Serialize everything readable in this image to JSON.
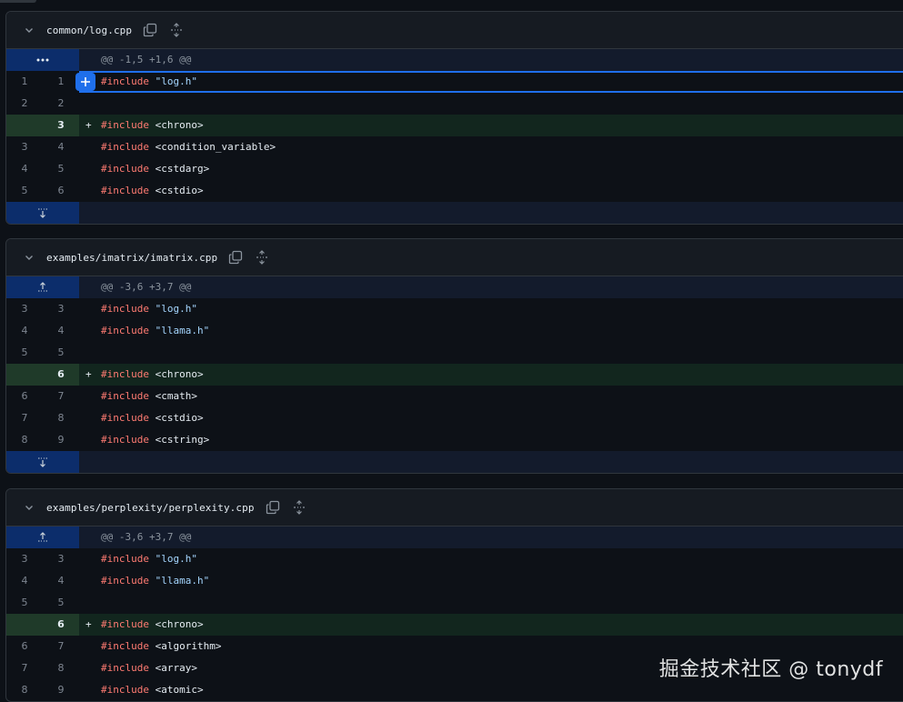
{
  "files": [
    {
      "name": "common/log.cpp",
      "hunk": "@@ -1,5 +1,6 @@",
      "hunk_type": "ellipsis",
      "lines": [
        {
          "type": "ctx",
          "old": "1",
          "new": "1",
          "pre": "#include",
          "arg": "\"log.h\"",
          "arg_kind": "str",
          "selected": true
        },
        {
          "type": "ctx",
          "old": "2",
          "new": "2",
          "pre": "",
          "arg": "",
          "arg_kind": "str"
        },
        {
          "type": "add",
          "old": "",
          "new": "3",
          "mark": "+",
          "pre": "#include",
          "arg": "<chrono>",
          "arg_kind": "plain"
        },
        {
          "type": "ctx",
          "old": "3",
          "new": "4",
          "pre": "#include",
          "arg": "<condition_variable>",
          "arg_kind": "plain"
        },
        {
          "type": "ctx",
          "old": "4",
          "new": "5",
          "pre": "#include",
          "arg": "<cstdarg>",
          "arg_kind": "plain"
        },
        {
          "type": "ctx",
          "old": "5",
          "new": "6",
          "pre": "#include",
          "arg": "<cstdio>",
          "arg_kind": "plain"
        }
      ]
    },
    {
      "name": "examples/imatrix/imatrix.cpp",
      "hunk": "@@ -3,6 +3,7 @@",
      "hunk_type": "expand-up",
      "lines": [
        {
          "type": "ctx",
          "old": "3",
          "new": "3",
          "pre": "#include",
          "arg": "\"log.h\"",
          "arg_kind": "str"
        },
        {
          "type": "ctx",
          "old": "4",
          "new": "4",
          "pre": "#include",
          "arg": "\"llama.h\"",
          "arg_kind": "str"
        },
        {
          "type": "ctx",
          "old": "5",
          "new": "5",
          "pre": "",
          "arg": "",
          "arg_kind": "str"
        },
        {
          "type": "add",
          "old": "",
          "new": "6",
          "mark": "+",
          "pre": "#include",
          "arg": "<chrono>",
          "arg_kind": "plain"
        },
        {
          "type": "ctx",
          "old": "6",
          "new": "7",
          "pre": "#include",
          "arg": "<cmath>",
          "arg_kind": "plain"
        },
        {
          "type": "ctx",
          "old": "7",
          "new": "8",
          "pre": "#include",
          "arg": "<cstdio>",
          "arg_kind": "plain"
        },
        {
          "type": "ctx",
          "old": "8",
          "new": "9",
          "pre": "#include",
          "arg": "<cstring>",
          "arg_kind": "plain"
        }
      ]
    },
    {
      "name": "examples/perplexity/perplexity.cpp",
      "hunk": "@@ -3,6 +3,7 @@",
      "hunk_type": "expand-up",
      "lines": [
        {
          "type": "ctx",
          "old": "3",
          "new": "3",
          "pre": "#include",
          "arg": "\"log.h\"",
          "arg_kind": "str"
        },
        {
          "type": "ctx",
          "old": "4",
          "new": "4",
          "pre": "#include",
          "arg": "\"llama.h\"",
          "arg_kind": "str"
        },
        {
          "type": "ctx",
          "old": "5",
          "new": "5",
          "pre": "",
          "arg": "",
          "arg_kind": "str"
        },
        {
          "type": "add",
          "old": "",
          "new": "6",
          "mark": "+",
          "pre": "#include",
          "arg": "<chrono>",
          "arg_kind": "plain"
        },
        {
          "type": "ctx",
          "old": "6",
          "new": "7",
          "pre": "#include",
          "arg": "<algorithm>",
          "arg_kind": "plain"
        },
        {
          "type": "ctx",
          "old": "7",
          "new": "8",
          "pre": "#include",
          "arg": "<array>",
          "arg_kind": "plain"
        },
        {
          "type": "ctx",
          "old": "8",
          "new": "9",
          "pre": "#include",
          "arg": "<atomic>",
          "arg_kind": "plain"
        }
      ]
    }
  ],
  "watermark": "掘金技术社区 @ tonydf",
  "colors": {
    "background": "#0d1117",
    "hunk_gutter": "#0c2d6b",
    "addition_gutter": "#1f3a29",
    "addition_line": "#12261e",
    "keyword": "#ff7b72",
    "string": "#a5d6ff",
    "accent": "#1f6feb"
  },
  "icons": {
    "collapse": "chevron-down-icon",
    "copy": "copy-icon",
    "expand": "unfold-icon",
    "hunk_more": "kebab-horizontal-icon",
    "expand_up": "expand-up-icon",
    "expand_down": "expand-down-icon",
    "add_comment": "plus-icon"
  }
}
